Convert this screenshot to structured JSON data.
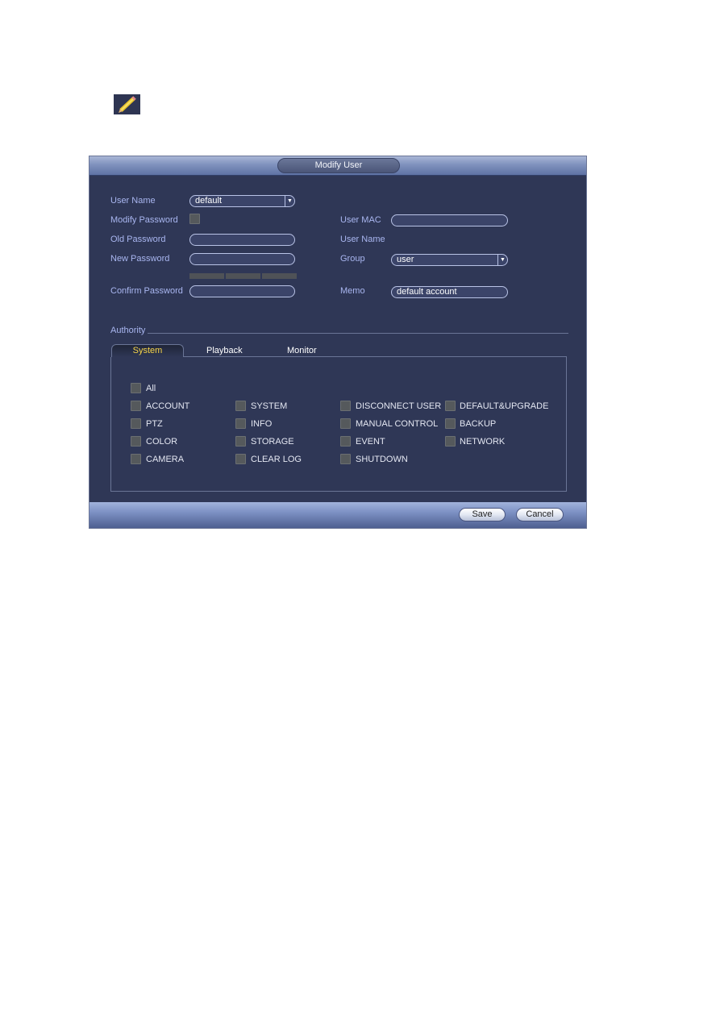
{
  "icons": {
    "pencil": "pencil-icon"
  },
  "dialog": {
    "title": "Modify User",
    "left": {
      "user_name_label": "User Name",
      "user_name_value": "default",
      "modify_password_label": "Modify Password",
      "modify_password_checked": false,
      "old_password_label": "Old Password",
      "old_password_value": "",
      "new_password_label": "New Password",
      "new_password_value": "",
      "confirm_password_label": "Confirm Password",
      "confirm_password_value": ""
    },
    "right": {
      "user_mac_label": "User MAC",
      "user_mac_value": "",
      "user_name_label": "User Name",
      "group_label": "Group",
      "group_value": "user",
      "memo_label": "Memo",
      "memo_value": "default account"
    },
    "authority": {
      "label": "Authority",
      "tabs": [
        {
          "label": "System",
          "active": true
        },
        {
          "label": "Playback",
          "active": false
        },
        {
          "label": "Monitor",
          "active": false
        }
      ],
      "all_label": "All",
      "permissions": [
        [
          "ACCOUNT",
          "SYSTEM",
          "DISCONNECT USER",
          "DEFAULT&UPGRADE"
        ],
        [
          "PTZ",
          "INFO",
          "MANUAL CONTROL",
          "BACKUP"
        ],
        [
          "COLOR",
          "STORAGE",
          "EVENT",
          "NETWORK"
        ],
        [
          "CAMERA",
          "CLEAR LOG",
          "SHUTDOWN"
        ]
      ]
    },
    "buttons": {
      "save": "Save",
      "cancel": "Cancel"
    }
  }
}
